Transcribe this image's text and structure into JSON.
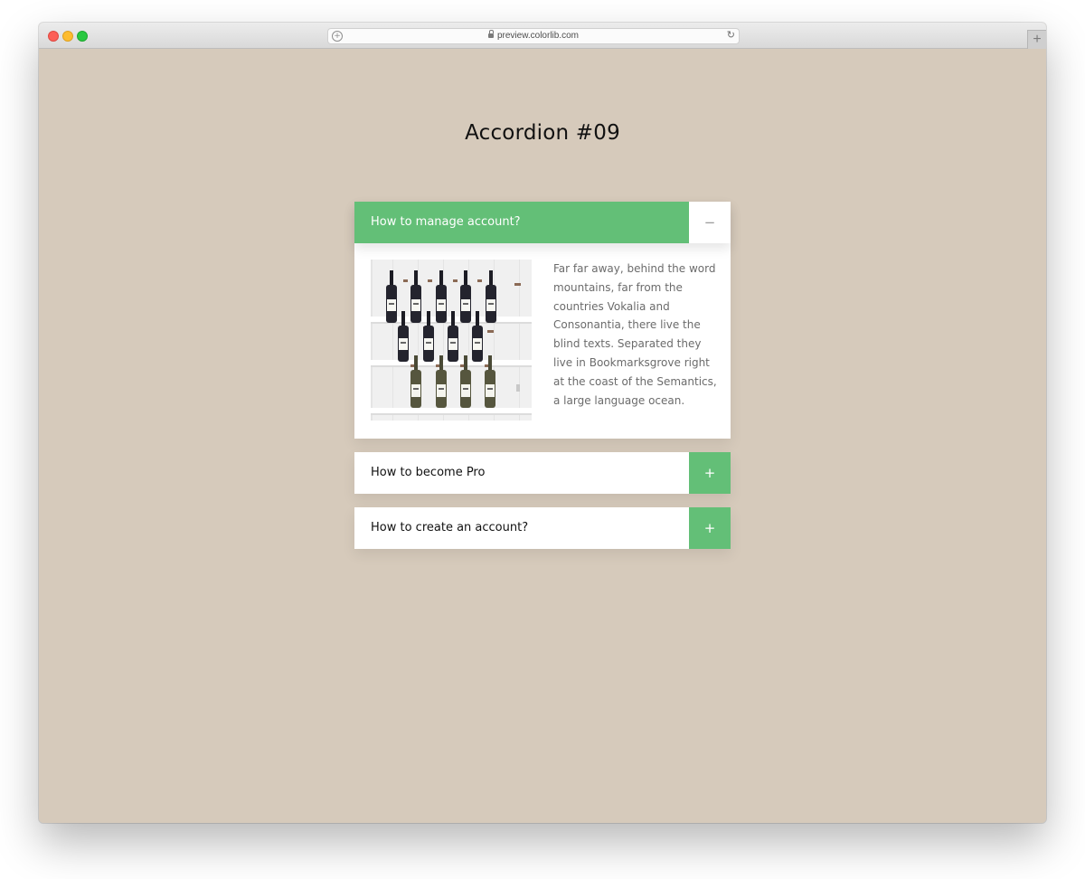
{
  "browser": {
    "url": "preview.colorlib.com",
    "new_tab_symbol": "+"
  },
  "page": {
    "title": "Accordion #09"
  },
  "accordion": {
    "items": [
      {
        "title": "How to manage account?",
        "expanded": true,
        "toggle_symbol": "−",
        "body": "Far far away, behind the word mountains, far from the countries Vokalia and Consonantia, there live the blind texts. Separated they live in Bookmarksgrove right at the coast of the Semantics, a large language ocean."
      },
      {
        "title": "How to become Pro",
        "expanded": false,
        "toggle_symbol": "+"
      },
      {
        "title": "How to create an account?",
        "expanded": false,
        "toggle_symbol": "+"
      }
    ]
  },
  "colors": {
    "background": "#d6cabb",
    "accent": "#63bf77",
    "panel": "#ffffff",
    "body_text": "#6b6b6b"
  }
}
